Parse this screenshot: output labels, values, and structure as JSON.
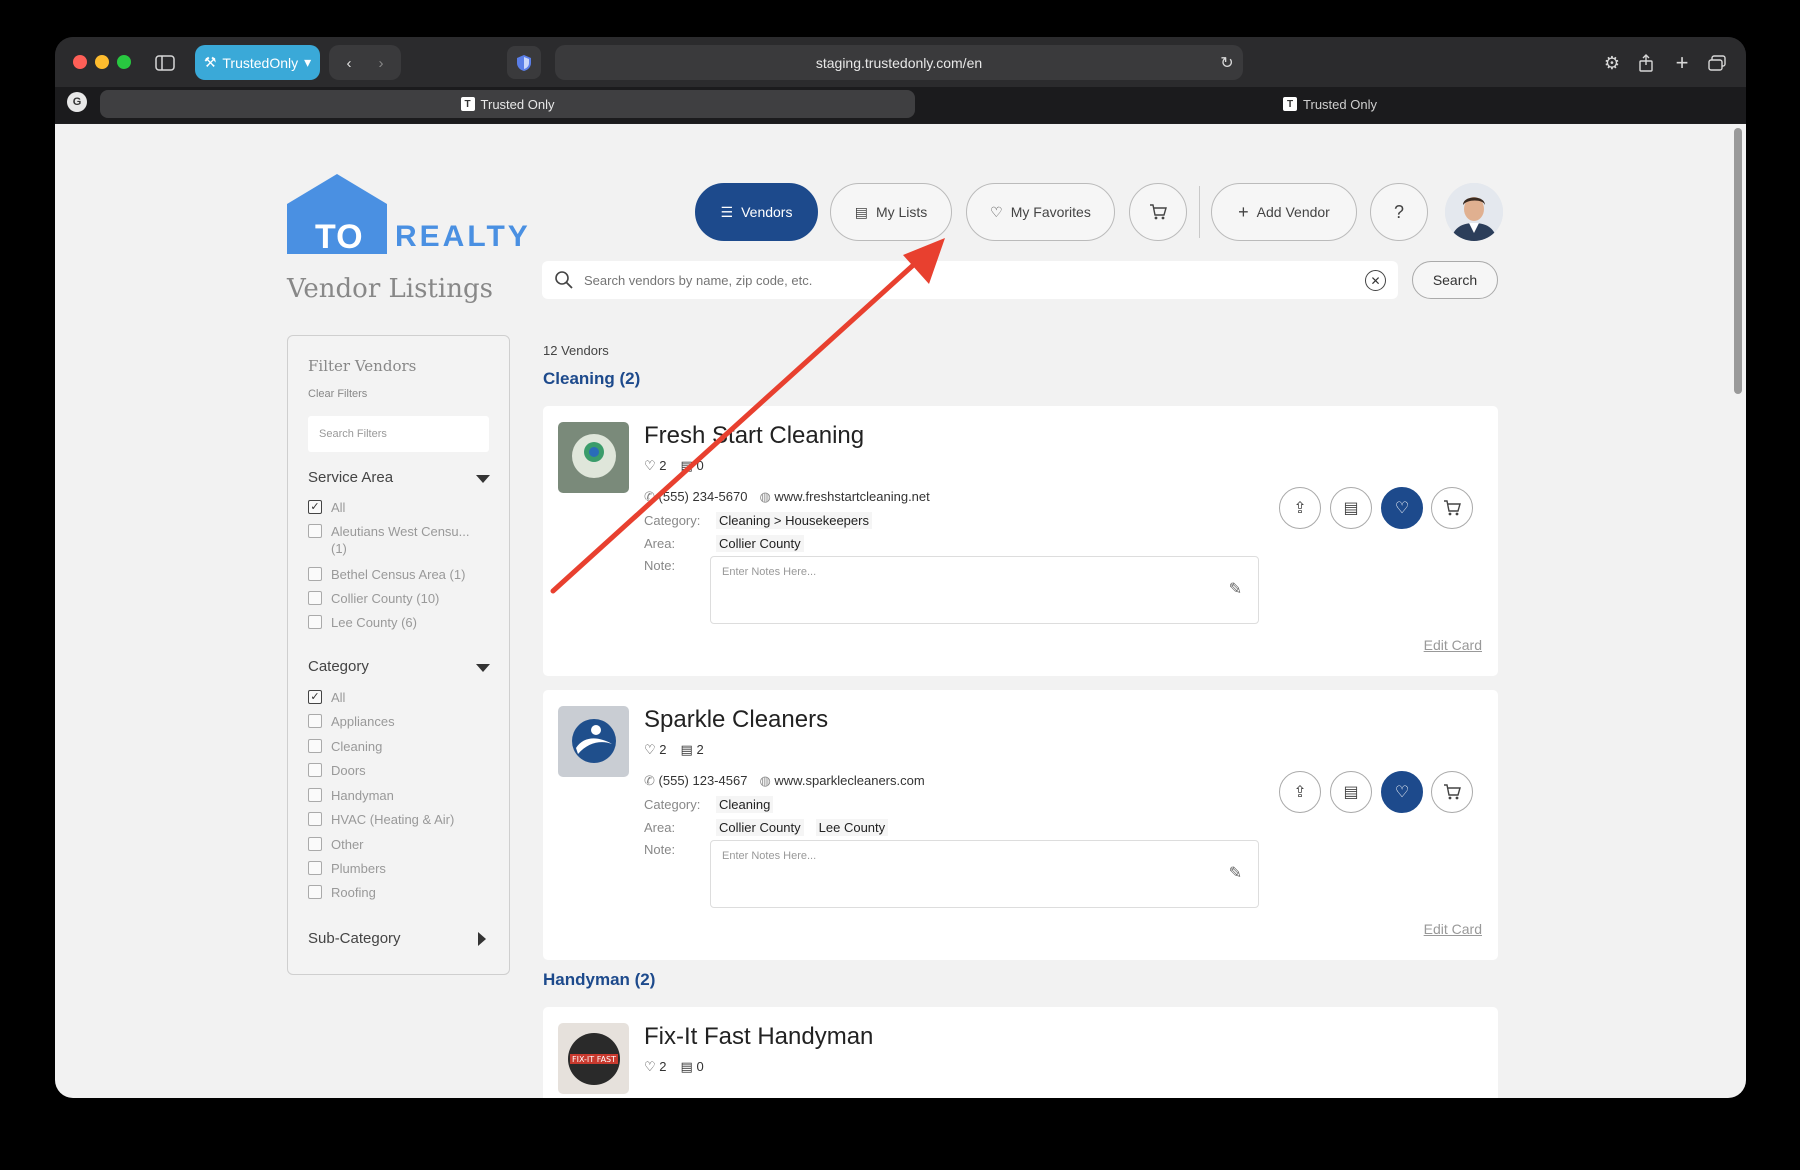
{
  "browser": {
    "profile_label": "TrustedOnly",
    "url": "staging.trustedonly.com/en",
    "tabs": [
      {
        "label": "Trusted Only",
        "active": true
      },
      {
        "label": "Trusted Only",
        "active": false
      }
    ]
  },
  "brand": {
    "logo_text_1": "TO",
    "logo_text_2": "REALTY",
    "color": "#4a90e2"
  },
  "page": {
    "title": "Vendor Listings"
  },
  "nav": {
    "vendors": "Vendors",
    "my_lists": "My Lists",
    "my_favorites": "My Favorites",
    "add_vendor": "Add Vendor",
    "help": "?"
  },
  "search": {
    "placeholder": "Search vendors by name, zip code, etc.",
    "button": "Search"
  },
  "filters": {
    "title": "Filter Vendors",
    "clear": "Clear Filters",
    "search_placeholder": "Search Filters",
    "service_area": {
      "label": "Service Area",
      "options": [
        {
          "label": "All",
          "checked": true
        },
        {
          "label": "Aleutians West Censu... (1)",
          "checked": false
        },
        {
          "label": "Bethel Census Area (1)",
          "checked": false
        },
        {
          "label": "Collier County (10)",
          "checked": false
        },
        {
          "label": "Lee County (6)",
          "checked": false
        }
      ]
    },
    "category": {
      "label": "Category",
      "options": [
        {
          "label": "All",
          "checked": true
        },
        {
          "label": "Appliances",
          "checked": false
        },
        {
          "label": "Cleaning",
          "checked": false
        },
        {
          "label": "Doors",
          "checked": false
        },
        {
          "label": "Handyman",
          "checked": false
        },
        {
          "label": "HVAC (Heating & Air)",
          "checked": false
        },
        {
          "label": "Other",
          "checked": false
        },
        {
          "label": "Plumbers",
          "checked": false
        },
        {
          "label": "Roofing",
          "checked": false
        }
      ]
    },
    "sub_category": {
      "label": "Sub-Category"
    }
  },
  "results": {
    "count_label": "12 Vendors",
    "groups": [
      {
        "title": "Cleaning (2)",
        "vendors": [
          {
            "name": "Fresh Start Cleaning",
            "likes": "2",
            "lists": "0",
            "phone": "(555) 234-5670",
            "website": "www.freshstartcleaning.net",
            "category": "Cleaning > Housekeepers",
            "areas": [
              "Collier County"
            ],
            "note_placeholder": "Enter Notes Here...",
            "edit": "Edit Card"
          },
          {
            "name": "Sparkle Cleaners",
            "likes": "2",
            "lists": "2",
            "phone": "(555) 123-4567",
            "website": "www.sparklecleaners.com",
            "category": "Cleaning",
            "areas": [
              "Collier County",
              "Lee County"
            ],
            "note_placeholder": "Enter Notes Here...",
            "edit": "Edit Card"
          }
        ]
      },
      {
        "title": "Handyman (2)",
        "vendors": [
          {
            "name": "Fix-It Fast Handyman",
            "likes": "2",
            "lists": "0"
          }
        ]
      }
    ],
    "labels": {
      "category": "Category:",
      "area": "Area:",
      "note": "Note:"
    }
  },
  "colors": {
    "primary": "#1d4a8c",
    "annotation_arrow": "#e8402f"
  }
}
